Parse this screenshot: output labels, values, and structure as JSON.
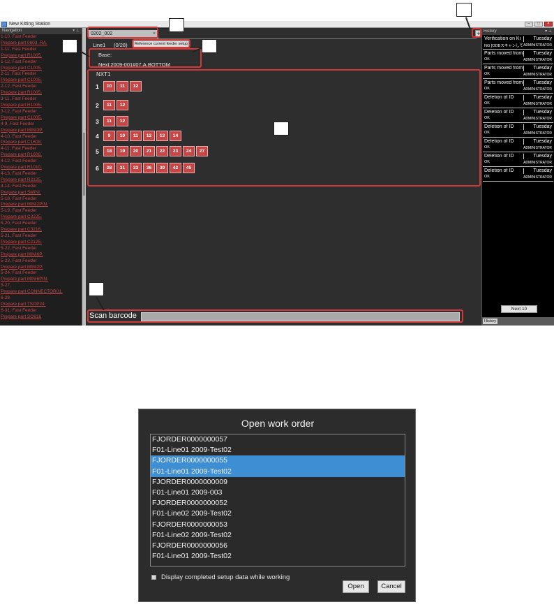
{
  "app": {
    "title": "New Kitting Station",
    "navigation_header": "Navigation",
    "history_header": "History",
    "pin_glyph": "▾ ⊥",
    "window_buttons": [
      "–",
      "□",
      "×"
    ]
  },
  "navigation": {
    "items": [
      {
        "l1": "1-10, Fast Feeder",
        "l2": "Prepare part 0603_RA."
      },
      {
        "l1": "1-11, Fast Feeder",
        "l2": "Prepare part R1005."
      },
      {
        "l1": "1-12, Fast Feeder",
        "l2": "Prepare part C1005."
      },
      {
        "l1": "2-11, Fast Feeder",
        "l2": "Prepare part C1005."
      },
      {
        "l1": "2-12, Fast Feeder",
        "l2": "Prepare part R1005."
      },
      {
        "l1": "3-11, Fast Feeder",
        "l2": "Prepare part R1005."
      },
      {
        "l1": "3-12, Fast Feeder",
        "l2": "Prepare part C1005."
      },
      {
        "l1": "4-9, Fast Feeder",
        "l2": "Prepare part MINI3P."
      },
      {
        "l1": "4-10, Fast Feeder",
        "l2": "Prepare part C1608."
      },
      {
        "l1": "4-11, Fast Feeder",
        "l2": "Prepare part R1608."
      },
      {
        "l1": "4-12, Fast Feeder",
        "l2": "Prepare part R1010."
      },
      {
        "l1": "4-13, Fast Feeder",
        "l2": "Prepare part R2125."
      },
      {
        "l1": "4-14, Fast Feeder",
        "l2": "Prepare part SMINI."
      },
      {
        "l1": "5-18, Fast Feeder",
        "l2": "Prepare part MINI2PIN."
      },
      {
        "l1": "5-19, Fast Feeder",
        "l2": "Prepare part C3225."
      },
      {
        "l1": "5-20, Fast Feeder",
        "l2": "Prepare part C3216."
      },
      {
        "l1": "5-21, Fast Feeder",
        "l2": "Prepare part C2125."
      },
      {
        "l1": "5-22, Fast Feeder",
        "l2": "Prepare part MINI6P."
      },
      {
        "l1": "5-23, Fast Feeder",
        "l2": "Prepare part MINI2P."
      },
      {
        "l1": "5-24, Fast Feeder",
        "l2": "Prepare part MINI6PIN."
      },
      {
        "l1": "5-27,",
        "l2": "Prepare part CONNECTOR01."
      },
      {
        "l1": "6-28",
        "l2": "Prepare part TSOP24."
      },
      {
        "l1": "6-31, Fast Feeder",
        "l2": "Prepare part SO816"
      }
    ]
  },
  "workspace": {
    "tab_label": "0202_002",
    "tab_close": "×",
    "line_label": "Line1",
    "progress": "(0/28)",
    "reference_button": "Reference current feeder setup",
    "base_label": "Base:",
    "next_label": "Next:2009-001#07,A,BOTTOM",
    "machine": "NXT1",
    "rows": [
      {
        "num": "1",
        "slots": [
          "10",
          "11",
          "12"
        ]
      },
      {
        "num": "2",
        "slots": [
          "11",
          "12"
        ]
      },
      {
        "num": "3",
        "slots": [
          "11",
          "12"
        ]
      },
      {
        "num": "4",
        "slots": [
          "9",
          "10",
          "11",
          "12",
          "13",
          "14"
        ]
      },
      {
        "num": "5",
        "slots": [
          "18",
          "19",
          "20",
          "21",
          "22",
          "23",
          "24",
          "27"
        ]
      },
      {
        "num": "6",
        "slots": [
          "28",
          "31",
          "33",
          "36",
          "39",
          "42",
          "45"
        ]
      }
    ],
    "scan_label": "Scan barcode",
    "scan_value": "",
    "add_button": "+"
  },
  "history": {
    "items": [
      {
        "action": "Verification on Ki",
        "status": "NG [ODBスキャンして下さい]",
        "day": "Tuesday",
        "user": "ADMINISTRATOR"
      },
      {
        "action": "Parts moved from",
        "status": "OK",
        "day": "Tuesday",
        "user": "ADMINISTRATOR"
      },
      {
        "action": "Parts moved from",
        "status": "OK",
        "day": "Tuesday",
        "user": "ADMINISTRATOR"
      },
      {
        "action": "Parts moved from",
        "status": "OK",
        "day": "Tuesday",
        "user": "ADMINISTRATOR"
      },
      {
        "action": "Deletion of ID",
        "status": "OK",
        "day": "Tuesday",
        "user": "ADMINISTRATOR"
      },
      {
        "action": "Deletion of ID",
        "status": "OK",
        "day": "Tuesday",
        "user": "ADMINISTRATOR"
      },
      {
        "action": "Deletion of ID",
        "status": "OK",
        "day": "Tuesday",
        "user": "ADMINISTRATOR"
      },
      {
        "action": "Deletion of ID",
        "status": "OK",
        "day": "Tuesday",
        "user": "ADMINISTRATOR"
      },
      {
        "action": "Deletion of ID",
        "status": "OK",
        "day": "Tuesday",
        "user": "ADMINISTRATOR"
      },
      {
        "action": "Deletion of ID",
        "status": "OK",
        "day": "Tuesday",
        "user": "ADMINISTRATOR"
      }
    ],
    "next_button": "Next 10",
    "tab_label": "History"
  },
  "dialog": {
    "title": "Open work order",
    "orders": [
      {
        "id": "FJORDER0000000057",
        "name": "F01-Line01 2009-Test02",
        "selected": false
      },
      {
        "id": "FJORDER0000000055",
        "name": "F01-Line01 2009-Test02",
        "selected": true
      },
      {
        "id": "FJORDER0000000009",
        "name": "F01-Line01 2009-003",
        "selected": false
      },
      {
        "id": "FJORDER0000000052",
        "name": "F01-Line02 2009-Test02",
        "selected": false
      },
      {
        "id": "FJORDER0000000053",
        "name": "F01-Line02 2009-Test02",
        "selected": false
      },
      {
        "id": "FJORDER0000000056",
        "name": "F01-Line01 2009-Test02",
        "selected": false
      }
    ],
    "checkbox_label": "Display completed setup data while working",
    "checkbox_checked": false,
    "open_button": "Open",
    "cancel_button": "Cancel"
  },
  "colors": {
    "slot_fill": "#c64545",
    "nav_text": "#c84646",
    "callout_red": "#d23a3a",
    "selection_blue": "#3e8ed4"
  }
}
